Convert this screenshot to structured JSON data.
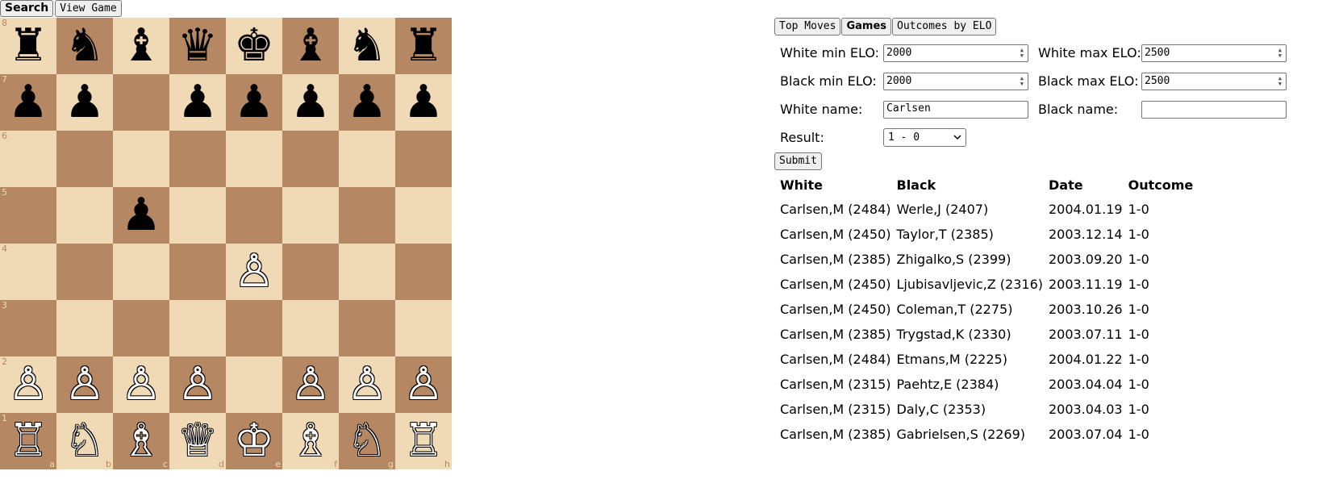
{
  "top_tabs": {
    "search": "Search",
    "view_game": "View Game"
  },
  "board": {
    "ranks": [
      "8",
      "7",
      "6",
      "5",
      "4",
      "3",
      "2",
      "1"
    ],
    "files": [
      "a",
      "b",
      "c",
      "d",
      "e",
      "f",
      "g",
      "h"
    ],
    "rows": [
      [
        "♜",
        "♞",
        "♝",
        "♛",
        "♚",
        "♝",
        "♞",
        "♜"
      ],
      [
        "♟",
        "♟",
        "",
        "♟",
        "♟",
        "♟",
        "♟",
        "♟"
      ],
      [
        "",
        "",
        "",
        "",
        "",
        "",
        "",
        ""
      ],
      [
        "",
        "",
        "♟",
        "",
        "",
        "",
        "",
        ""
      ],
      [
        "",
        "",
        "",
        "",
        "♙",
        "",
        "",
        ""
      ],
      [
        "",
        "",
        "",
        "",
        "",
        "",
        "",
        ""
      ],
      [
        "♙",
        "♙",
        "♙",
        "♙",
        "",
        "♙",
        "♙",
        "♙"
      ],
      [
        "♖",
        "♘",
        "♗",
        "♕",
        "♔",
        "♗",
        "♘",
        "♖"
      ]
    ],
    "colors": {
      "light": "#f0d9b5",
      "dark": "#b58863"
    }
  },
  "sub_tabs": {
    "top_moves": "Top Moves",
    "games": "Games",
    "outcomes": "Outcomes by ELO"
  },
  "form": {
    "white_min_label": "White min ELO:",
    "white_min_value": "2000",
    "white_max_label": "White max ELO:",
    "white_max_value": "2500",
    "black_min_label": "Black min ELO:",
    "black_min_value": "2000",
    "black_max_label": "Black max ELO:",
    "black_max_value": "2500",
    "white_name_label": "White name:",
    "white_name_value": "Carlsen",
    "black_name_label": "Black name:",
    "black_name_value": "",
    "result_label": "Result:",
    "result_value": "1 - 0",
    "submit_label": "Submit"
  },
  "table": {
    "headers": [
      "White",
      "Black",
      "Date",
      "Outcome"
    ],
    "rows": [
      [
        "Carlsen,M (2484)",
        "Werle,J (2407)",
        "2004.01.19",
        "1-0"
      ],
      [
        "Carlsen,M (2450)",
        "Taylor,T (2385)",
        "2003.12.14",
        "1-0"
      ],
      [
        "Carlsen,M (2385)",
        "Zhigalko,S (2399)",
        "2003.09.20",
        "1-0"
      ],
      [
        "Carlsen,M (2450)",
        "Ljubisavljevic,Z (2316)",
        "2003.11.19",
        "1-0"
      ],
      [
        "Carlsen,M (2450)",
        "Coleman,T (2275)",
        "2003.10.26",
        "1-0"
      ],
      [
        "Carlsen,M (2385)",
        "Trygstad,K (2330)",
        "2003.07.11",
        "1-0"
      ],
      [
        "Carlsen,M (2484)",
        "Etmans,M (2225)",
        "2004.01.22",
        "1-0"
      ],
      [
        "Carlsen,M (2315)",
        "Paehtz,E (2384)",
        "2003.04.04",
        "1-0"
      ],
      [
        "Carlsen,M (2315)",
        "Daly,C (2353)",
        "2003.04.03",
        "1-0"
      ],
      [
        "Carlsen,M (2385)",
        "Gabrielsen,S (2269)",
        "2003.07.04",
        "1-0"
      ]
    ]
  }
}
